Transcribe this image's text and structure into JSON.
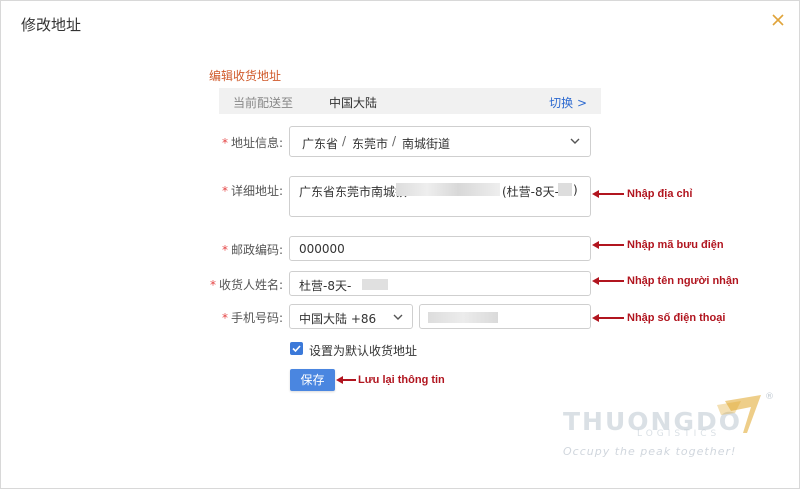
{
  "dialog": {
    "title": "修改地址",
    "section_title": "编辑收货地址"
  },
  "deliver": {
    "label": "当前配送至",
    "value": "中国大陆",
    "switch_label": "切换 >"
  },
  "fields": {
    "address_info": {
      "label": "地址信息:",
      "province": "广东省",
      "city": "东莞市",
      "district": "南城街道",
      "separator": "/"
    },
    "detail": {
      "label": "详细地址:",
      "value_start": "广东省东莞市南城镇",
      "value_mid": "(杜营-8天-",
      "value_end": ")"
    },
    "zip": {
      "label": "邮政编码:",
      "value": "000000"
    },
    "name": {
      "label": "收货人姓名:",
      "value": "杜营-8天-"
    },
    "phone": {
      "label": "手机号码:",
      "country_code": "中国大陆 +86"
    }
  },
  "default_checkbox": {
    "label": "设置为默认收货地址",
    "checked": true
  },
  "save_button": {
    "label": "保存"
  },
  "annotations": {
    "address": "Nhập địa chỉ",
    "zip": "Nhập mã bưu điện",
    "name": "Nhập tên người  nhận",
    "phone": "Nhập số điện thoại",
    "save": "Lưu lại thông tin"
  },
  "watermark": {
    "brand": "THUONGDO",
    "sub": "LOGISTICS",
    "tagline": "Occupy the peak together!",
    "registered": "®"
  },
  "colors": {
    "accent_orange": "#d05a2b",
    "link_blue": "#2f6bd0",
    "button_blue": "#4a86e0",
    "annotation_red": "#b1151f",
    "required_star": "#e54646"
  },
  "icons": {
    "close": "close-icon",
    "dropdown": "chevron-down-icon",
    "check": "check-icon"
  }
}
